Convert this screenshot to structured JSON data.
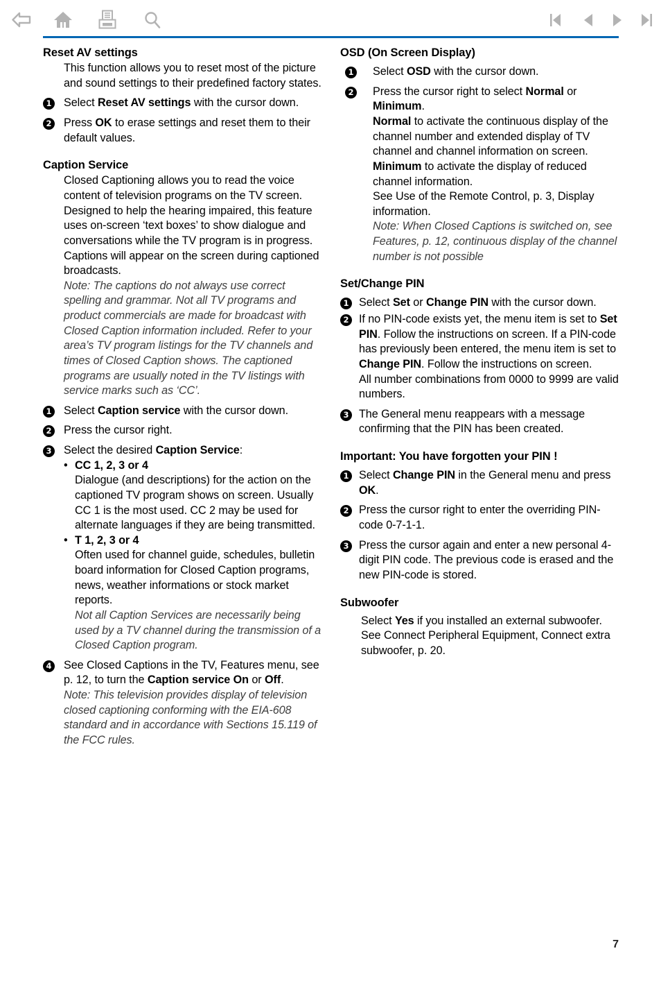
{
  "toolbar": {
    "icons_left": [
      {
        "name": "back-icon",
        "label": "Back"
      },
      {
        "name": "home-icon",
        "label": "Home"
      },
      {
        "name": "print-icon",
        "label": "Print"
      },
      {
        "name": "search-icon",
        "label": "Search"
      }
    ],
    "icons_right": [
      {
        "name": "first-page-icon",
        "label": "First page"
      },
      {
        "name": "previous-page-icon",
        "label": "Previous page"
      },
      {
        "name": "next-page-icon",
        "label": "Next page"
      },
      {
        "name": "last-page-icon",
        "label": "Last page"
      }
    ],
    "rule_color": "#0066b3",
    "icon_color": "#b3b3b3"
  },
  "page": {
    "number": "7"
  },
  "left_column": {
    "reset_av": {
      "heading": "Reset AV settings",
      "intro": "This function allows you to reset most of the picture and sound settings to their predefined factory states.",
      "step1_pre": "Select ",
      "step1_bold": "Reset AV settings",
      "step1_post": " with the cursor down.",
      "step2_pre": "Press ",
      "step2_bold": "OK",
      "step2_post": " to erase settings and reset them to their default values."
    },
    "caption_service": {
      "heading": "Caption Service",
      "intro": "Closed Captioning allows you to read the voice content of television programs on the TV screen. Designed to help the hearing impaired, this feature uses on-screen ‘text boxes’ to show dialogue and conversations while the TV program is in progress. Captions will appear on the screen during captioned broadcasts.",
      "note1": "Note: The captions do not always use correct spelling and grammar. Not all TV programs and product commercials are made for broadcast with Closed Caption information included. Refer to your area’s TV program listings for the TV channels and times of Closed Caption shows. The captioned programs are usually noted in the TV listings with service marks such as ‘CC’.",
      "step1_pre": "Select ",
      "step1_bold": "Caption service",
      "step1_post": " with the cursor down.",
      "step2": "Press the cursor right.",
      "step3_pre": "Select the desired ",
      "step3_bold": "Caption Service",
      "step3_post": ":",
      "bullet1_title": "CC 1, 2, 3 or 4",
      "bullet1_body": "Dialogue (and descriptions) for the action on the captioned TV program shows on screen. Usually CC 1 is the most used. CC 2 may be used for alternate languages if they are being transmitted.",
      "bullet2_title": "T 1, 2, 3 or 4",
      "bullet2_body": "Often used for channel guide, schedules, bulletin board information for Closed Caption programs, news, weather informations or stock market reports.",
      "bullet2_note": "Not all Caption Services are necessarily being used by a TV channel during the transmission of a Closed Caption program.",
      "step4_part1": "See Closed Captions in the TV, Features menu, see p. 12, to turn the ",
      "step4_bold1": "Caption service On",
      "step4_mid": " or ",
      "step4_bold2": "Off",
      "step4_end": ".",
      "note2": "Note: This television provides display of television closed captioning conforming with the EIA-608 standard and in accordance with Sections 15.119 of the FCC rules."
    }
  },
  "right_column": {
    "osd": {
      "heading": "OSD (On Screen Display)",
      "step1_pre": "Select ",
      "step1_bold": "OSD",
      "step1_post": " with the cursor down.",
      "step2_pre": "Press the cursor right to select ",
      "step2_bold1": "Normal",
      "step2_mid": " or ",
      "step2_bold2": "Minimum",
      "step2_end": ".",
      "step2_line2_bold": "Normal",
      "step2_line2": " to activate the continuous display of the channel number and extended display of TV channel and channel information on screen.",
      "step2_line3_bold": "Minimum",
      "step2_line3": " to activate the display of reduced channel information.",
      "step2_line4": "See Use of the Remote Control, p. 3, Display information.",
      "note": "Note: When Closed Captions is switched on, see Features, p. 12, continuous display of the channel number is not possible"
    },
    "pin": {
      "heading": "Set/Change PIN",
      "step1_pre": "Select ",
      "step1_bold1": "Set",
      "step1_mid": " or ",
      "step1_bold2": "Change PIN",
      "step1_post": " with the cursor down.",
      "step2_pre": "If no PIN-code exists yet, the menu item is set to ",
      "step2_bold1": "Set PIN",
      "step2_mid": ". Follow the instructions on screen. If a PIN-code has previously been entered, the menu item is set to ",
      "step2_bold2": "Change PIN",
      "step2_post": ". Follow the instructions on screen.",
      "step2_line2": "All number combinations from 0000 to 9999 are valid numbers.",
      "step3": "The General menu reappears with a message confirming that the PIN has been created."
    },
    "forgot_pin": {
      "heading": "Important: You have forgotten your PIN !",
      "step1_pre": "Select ",
      "step1_bold1": "Change PIN",
      "step1_mid": " in the General menu and press ",
      "step1_bold2": "OK",
      "step1_post": ".",
      "step2": "Press the cursor right to enter the overriding PIN-code 0-7-1-1.",
      "step3": "Press the cursor again and enter a new personal 4-digit PIN code. The previous code is erased and the new PIN-code is stored."
    },
    "subwoofer": {
      "heading": "Subwoofer",
      "body_pre": "Select ",
      "body_bold": "Yes",
      "body_post": " if you installed an external subwoofer. See Connect Peripheral Equipment, Connect extra subwoofer, p. 20."
    }
  },
  "numerals": {
    "one": "1",
    "two": "2",
    "three": "3",
    "four": "4"
  },
  "bullet_dot": "•"
}
